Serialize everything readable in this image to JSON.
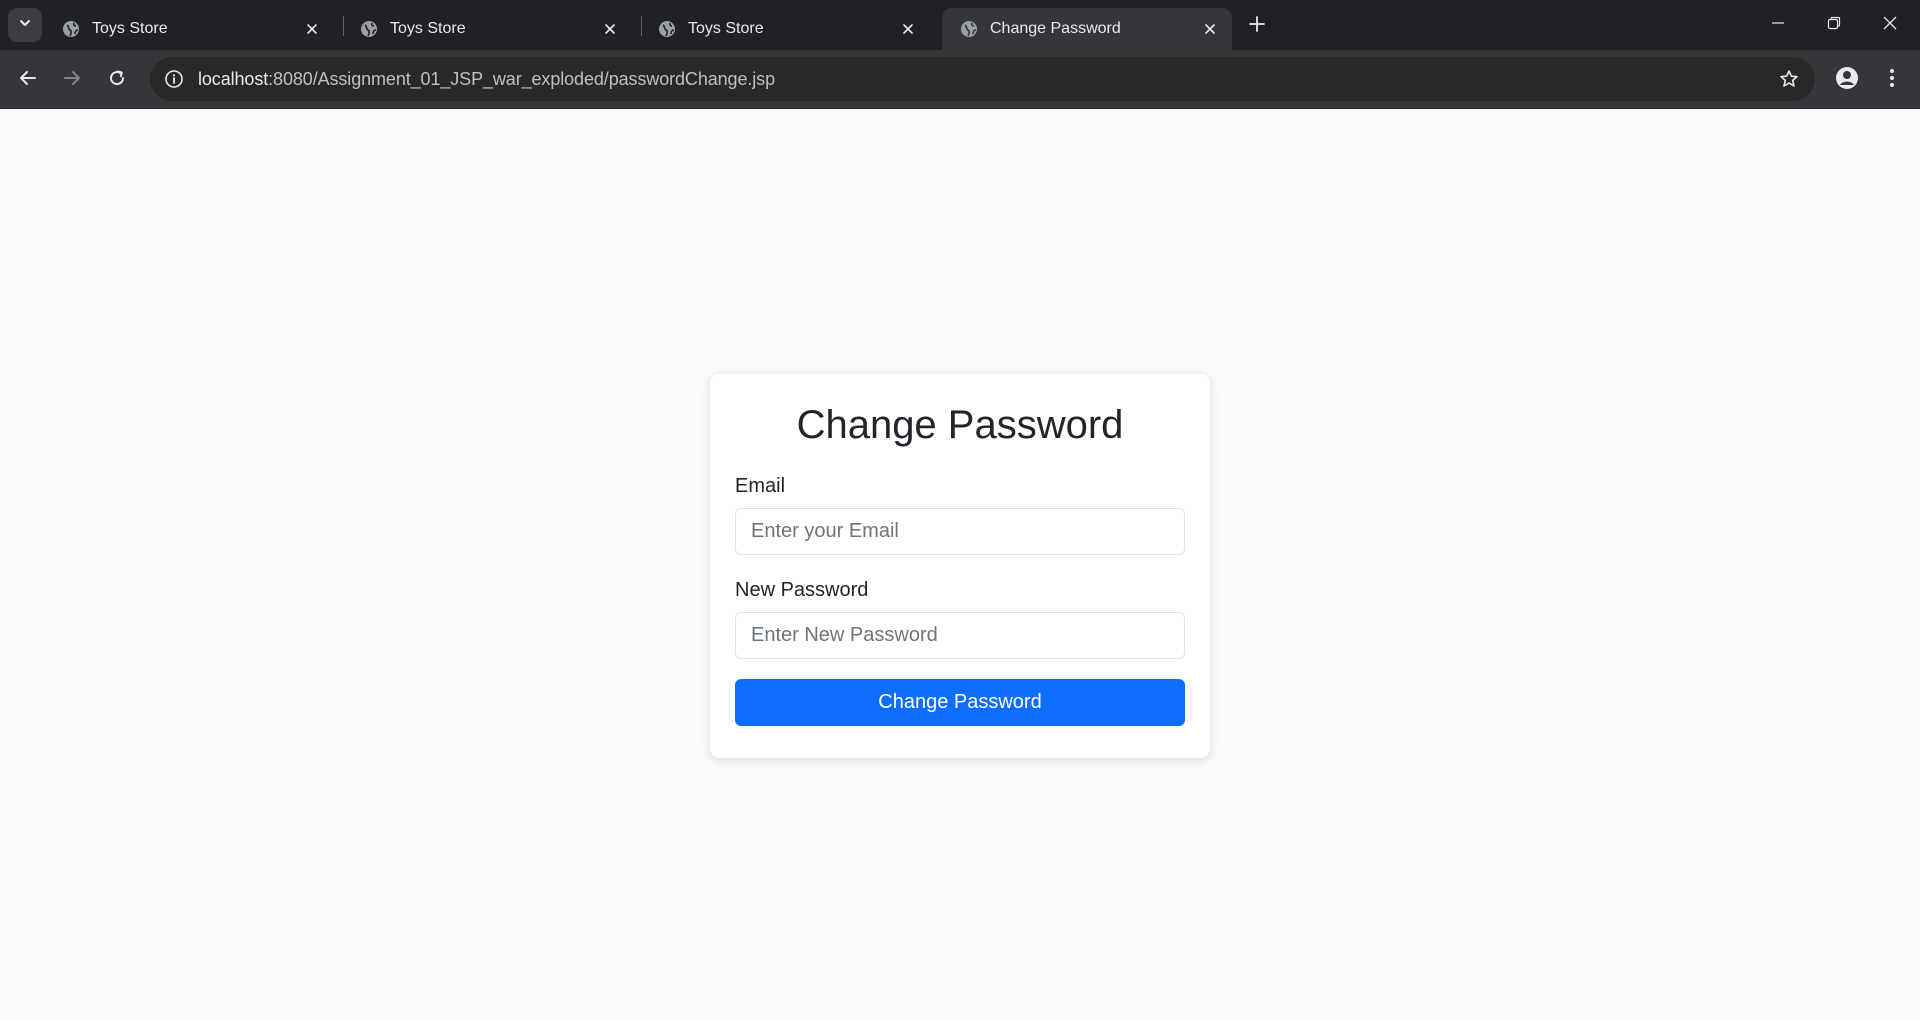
{
  "browser": {
    "tabs": [
      {
        "title": "Toys Store",
        "active": false
      },
      {
        "title": "Toys Store",
        "active": false
      },
      {
        "title": "Toys Store",
        "active": false
      },
      {
        "title": "Change Password",
        "active": true
      }
    ],
    "address": {
      "host": "localhost",
      "path": ":8080/Assignment_01_JSP_war_exploded/passwordChange.jsp"
    }
  },
  "form": {
    "title": "Change Password",
    "email": {
      "label": "Email",
      "value": "",
      "placeholder": "Enter your Email"
    },
    "password": {
      "label": "New Password",
      "value": "",
      "placeholder": "Enter New Password"
    },
    "submit_label": "Change Password"
  },
  "colors": {
    "primary": "#0d6efd",
    "page_bg": "#f8f9fa",
    "tabstrip_bg": "#202124",
    "toolbar_bg": "#35363a"
  }
}
